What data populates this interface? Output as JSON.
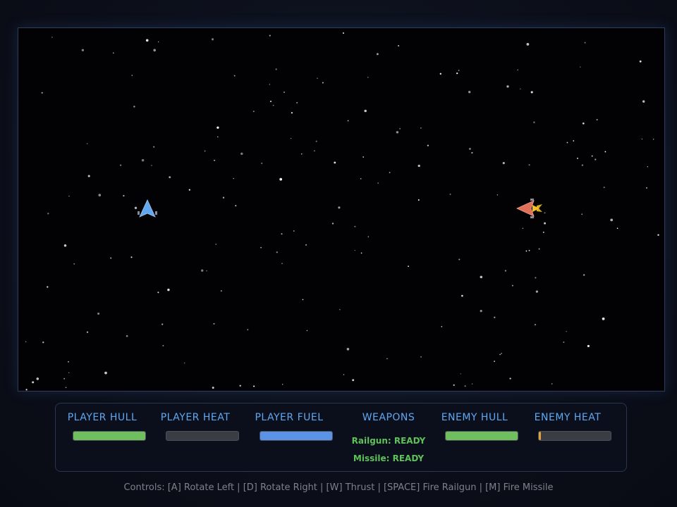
{
  "hud": {
    "panels": [
      {
        "title": "PLAYER HULL",
        "level": 1.0,
        "color": "#6fbf5e"
      },
      {
        "title": "PLAYER HEAT",
        "level": 0.0,
        "color": "#e0a23a"
      },
      {
        "title": "PLAYER FUEL",
        "level": 1.0,
        "color": "#5b93e6"
      },
      {
        "title": "WEAPONS"
      },
      {
        "title": "ENEMY HULL",
        "level": 1.0,
        "color": "#6fbf5e"
      },
      {
        "title": "ENEMY HEAT",
        "level": 0.03,
        "color": "#e0a23a"
      }
    ],
    "weapons": {
      "railgun": "Railgun: READY",
      "missile": "Missile: READY"
    },
    "title_color": "#5ea8f2",
    "ready_color": "#5ec15a"
  },
  "controls": "Controls: [A] Rotate Left | [D] Rotate Right | [W] Thrust | [SPACE] Fire Railgun | [M] Fire Missile",
  "ships": {
    "player": {
      "icon": "player-ship-icon",
      "color": "#62a8ee",
      "heading": "up"
    },
    "enemy": {
      "icon": "enemy-ship-icon",
      "color": "#e07058",
      "heading": "left",
      "thruster_color": "#f2c024"
    }
  }
}
